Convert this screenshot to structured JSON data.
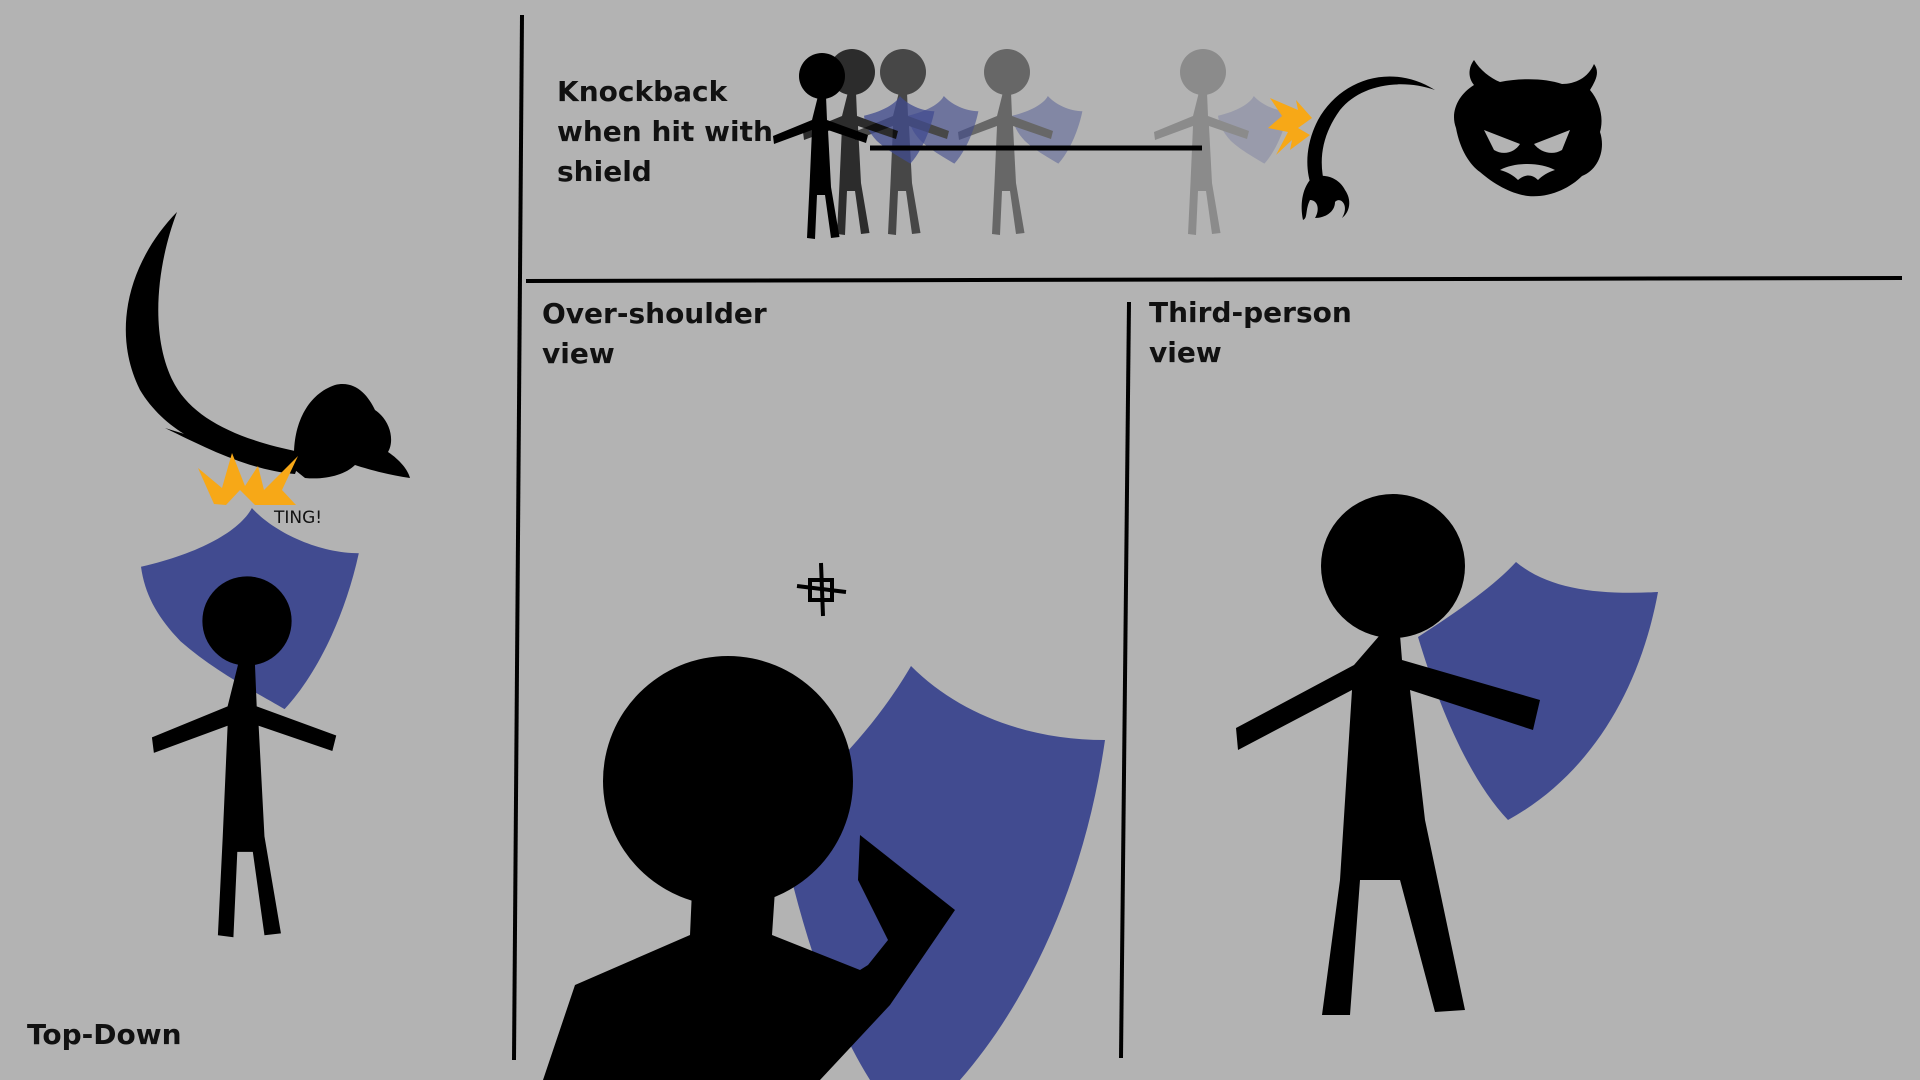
{
  "panels": {
    "top_down": {
      "title": "Top-Down",
      "sfx": "TING!"
    },
    "knockback": {
      "title": "Knockback\nwhen hit with\nshield"
    },
    "over_shoulder": {
      "title": "Over-shoulder\nview"
    },
    "third_person": {
      "title": "Third-person\nview"
    }
  },
  "colors": {
    "background": "#b3b3b3",
    "shield": "#414b90",
    "figure": "#000000",
    "impact": "#f7a817",
    "divider": "#000000"
  },
  "icons": {
    "claw": "claw-slash-icon",
    "monster": "horned-monster-icon",
    "crosshair": "crosshair-icon",
    "impact": "impact-spark-icon"
  }
}
